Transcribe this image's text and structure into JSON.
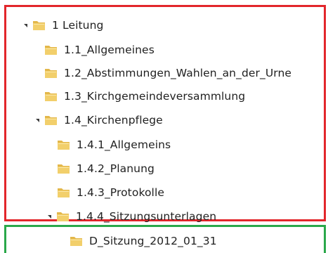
{
  "tree": {
    "items": [
      {
        "label": "1 Leitung",
        "expanded": true,
        "icon": "folder-icon"
      },
      {
        "label": "1.1_Allgemeines",
        "expanded": false,
        "icon": "folder-icon"
      },
      {
        "label": "1.2_Abstimmungen_Wahlen_an_der_Urne",
        "expanded": false,
        "icon": "folder-icon"
      },
      {
        "label": "1.3_Kirchgemeindeversammlung",
        "expanded": false,
        "icon": "folder-icon"
      },
      {
        "label": "1.4_Kirchenpflege",
        "expanded": true,
        "icon": "folder-icon"
      },
      {
        "label": "1.4.1_Allgemeins",
        "expanded": false,
        "icon": "folder-icon"
      },
      {
        "label": "1.4.2_Planung",
        "expanded": false,
        "icon": "folder-icon"
      },
      {
        "label": "1.4.3_Protokolle",
        "expanded": false,
        "icon": "folder-icon"
      },
      {
        "label": "1.4.4_Sitzungsunterlagen",
        "expanded": true,
        "icon": "folder-icon"
      },
      {
        "label": "D_Sitzung_2012_01_31",
        "expanded": false,
        "icon": "folder-icon"
      }
    ]
  },
  "colors": {
    "highlight_red": "#e2262b",
    "highlight_green": "#2aa84a",
    "folder_yellow": "#f2cf6b",
    "text": "#1f1f1f"
  }
}
